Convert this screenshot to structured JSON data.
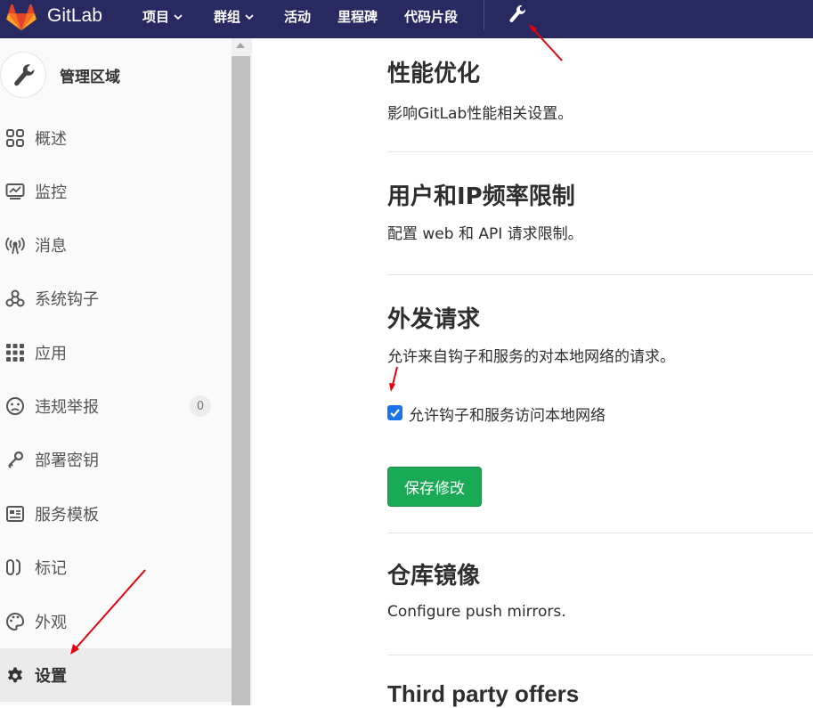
{
  "topbar": {
    "brand": "GitLab",
    "nav": [
      {
        "label": "项目"
      },
      {
        "label": "群组"
      },
      {
        "label": "活动"
      },
      {
        "label": "里程碑"
      },
      {
        "label": "代码片段"
      }
    ]
  },
  "sidebar": {
    "title": "管理区域",
    "items": [
      {
        "label": "概述",
        "icon": "overview-grid-icon"
      },
      {
        "label": "监控",
        "icon": "monitor-icon"
      },
      {
        "label": "消息",
        "icon": "broadcast-icon"
      },
      {
        "label": "系统钩子",
        "icon": "hook-icon"
      },
      {
        "label": "应用",
        "icon": "apps-grid-icon"
      },
      {
        "label": "违规举报",
        "icon": "frown-icon",
        "badge": "0"
      },
      {
        "label": "部署密钥",
        "icon": "key-icon"
      },
      {
        "label": "服务模板",
        "icon": "template-icon"
      },
      {
        "label": "标记",
        "icon": "labels-icon"
      },
      {
        "label": "外观",
        "icon": "palette-icon"
      },
      {
        "label": "设置",
        "icon": "gear-icon",
        "active": true
      }
    ]
  },
  "sections": {
    "performance": {
      "title": "性能优化",
      "desc": "影响GitLab性能相关设置。"
    },
    "ratelimit": {
      "title": "用户和IP频率限制",
      "desc": "配置 web 和 API 请求限制。"
    },
    "outbound": {
      "title": "外发请求",
      "desc": "允许来自钩子和服务的对本地网络的请求。",
      "checkbox_label": "允许钩子和服务访问本地网络",
      "checked": true
    },
    "save_label": "保存修改",
    "mirror": {
      "title": "仓库镜像",
      "desc": "Configure push mirrors."
    },
    "thirdparty": {
      "title": "Third party offers"
    }
  },
  "colors": {
    "topbar": "#292961",
    "save_button": "#1aaa55",
    "annotation_arrow": "#e8000b",
    "logo_orange": "#e24329"
  }
}
